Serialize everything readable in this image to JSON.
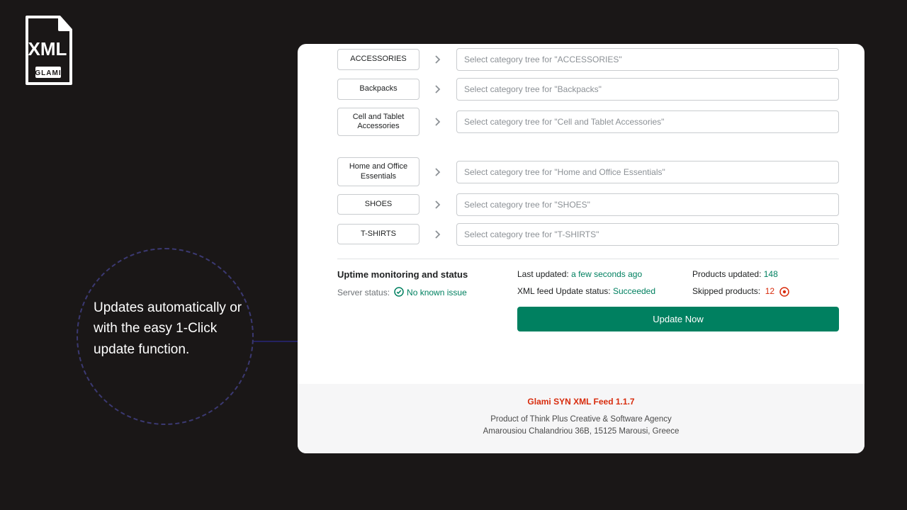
{
  "callout": "Updates automatically or with the easy 1-Click update function.",
  "categories": [
    {
      "label": "ACCESSORIES",
      "placeholder": "Select category tree for \"ACCESSORIES\"",
      "tall": false
    },
    {
      "label": "Backpacks",
      "placeholder": "Select category tree for \"Backpacks\"",
      "tall": false
    },
    {
      "label": "Cell and Tablet Accessories",
      "placeholder": "Select category tree for \"Cell and Tablet Accessories\"",
      "tall": true
    },
    {
      "label": "Home and Office Essentials",
      "placeholder": "Select category tree for \"Home and Office Essentials\"",
      "tall": true,
      "gapBefore": true
    },
    {
      "label": "SHOES",
      "placeholder": "Select category tree for \"SHOES\"",
      "tall": false
    },
    {
      "label": "T-SHIRTS",
      "placeholder": "Select category tree for \"T-SHIRTS\"",
      "tall": false
    }
  ],
  "status": {
    "heading": "Uptime monitoring and status",
    "server_label": "Server status:",
    "server_value": "No known issue",
    "last_updated_label": "Last updated:",
    "last_updated_value": "a few seconds ago",
    "feed_label": "XML feed Update status:",
    "feed_value": "Succeeded",
    "products_updated_label": "Products updated:",
    "products_updated_value": "148",
    "skipped_label": "Skipped products:",
    "skipped_value": "12",
    "button": "Update Now"
  },
  "footer": {
    "title": "Glami SYN XML Feed 1.1.7",
    "line1": "Product of Think Plus Creative & Software Agency",
    "line2": "Amarousiou Chalandriou 36B, 15125 Marousi, Greece"
  }
}
